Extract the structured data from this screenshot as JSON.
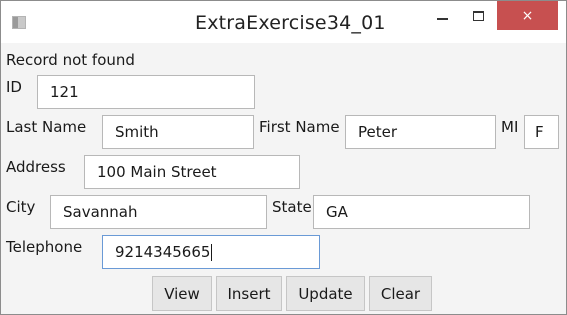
{
  "window": {
    "title": "ExtraExercise34_01",
    "close_glyph": "×"
  },
  "status": "Record not found",
  "form": {
    "id": {
      "label": "ID",
      "value": "121"
    },
    "last_name": {
      "label": "Last Name",
      "value": "Smith"
    },
    "first_name": {
      "label": "First Name",
      "value": "Peter"
    },
    "mi": {
      "label": "MI",
      "value": "F"
    },
    "address": {
      "label": "Address",
      "value": "100 Main Street"
    },
    "city": {
      "label": "City",
      "value": "Savannah"
    },
    "state": {
      "label": "State",
      "value": "GA"
    },
    "telephone": {
      "label": "Telephone",
      "value": "9214345665"
    }
  },
  "buttons": {
    "view": "View",
    "insert": "Insert",
    "update": "Update",
    "clear": "Clear"
  },
  "colors": {
    "close_button_bg": "#c75050",
    "focus_border": "#6a9ad6"
  }
}
